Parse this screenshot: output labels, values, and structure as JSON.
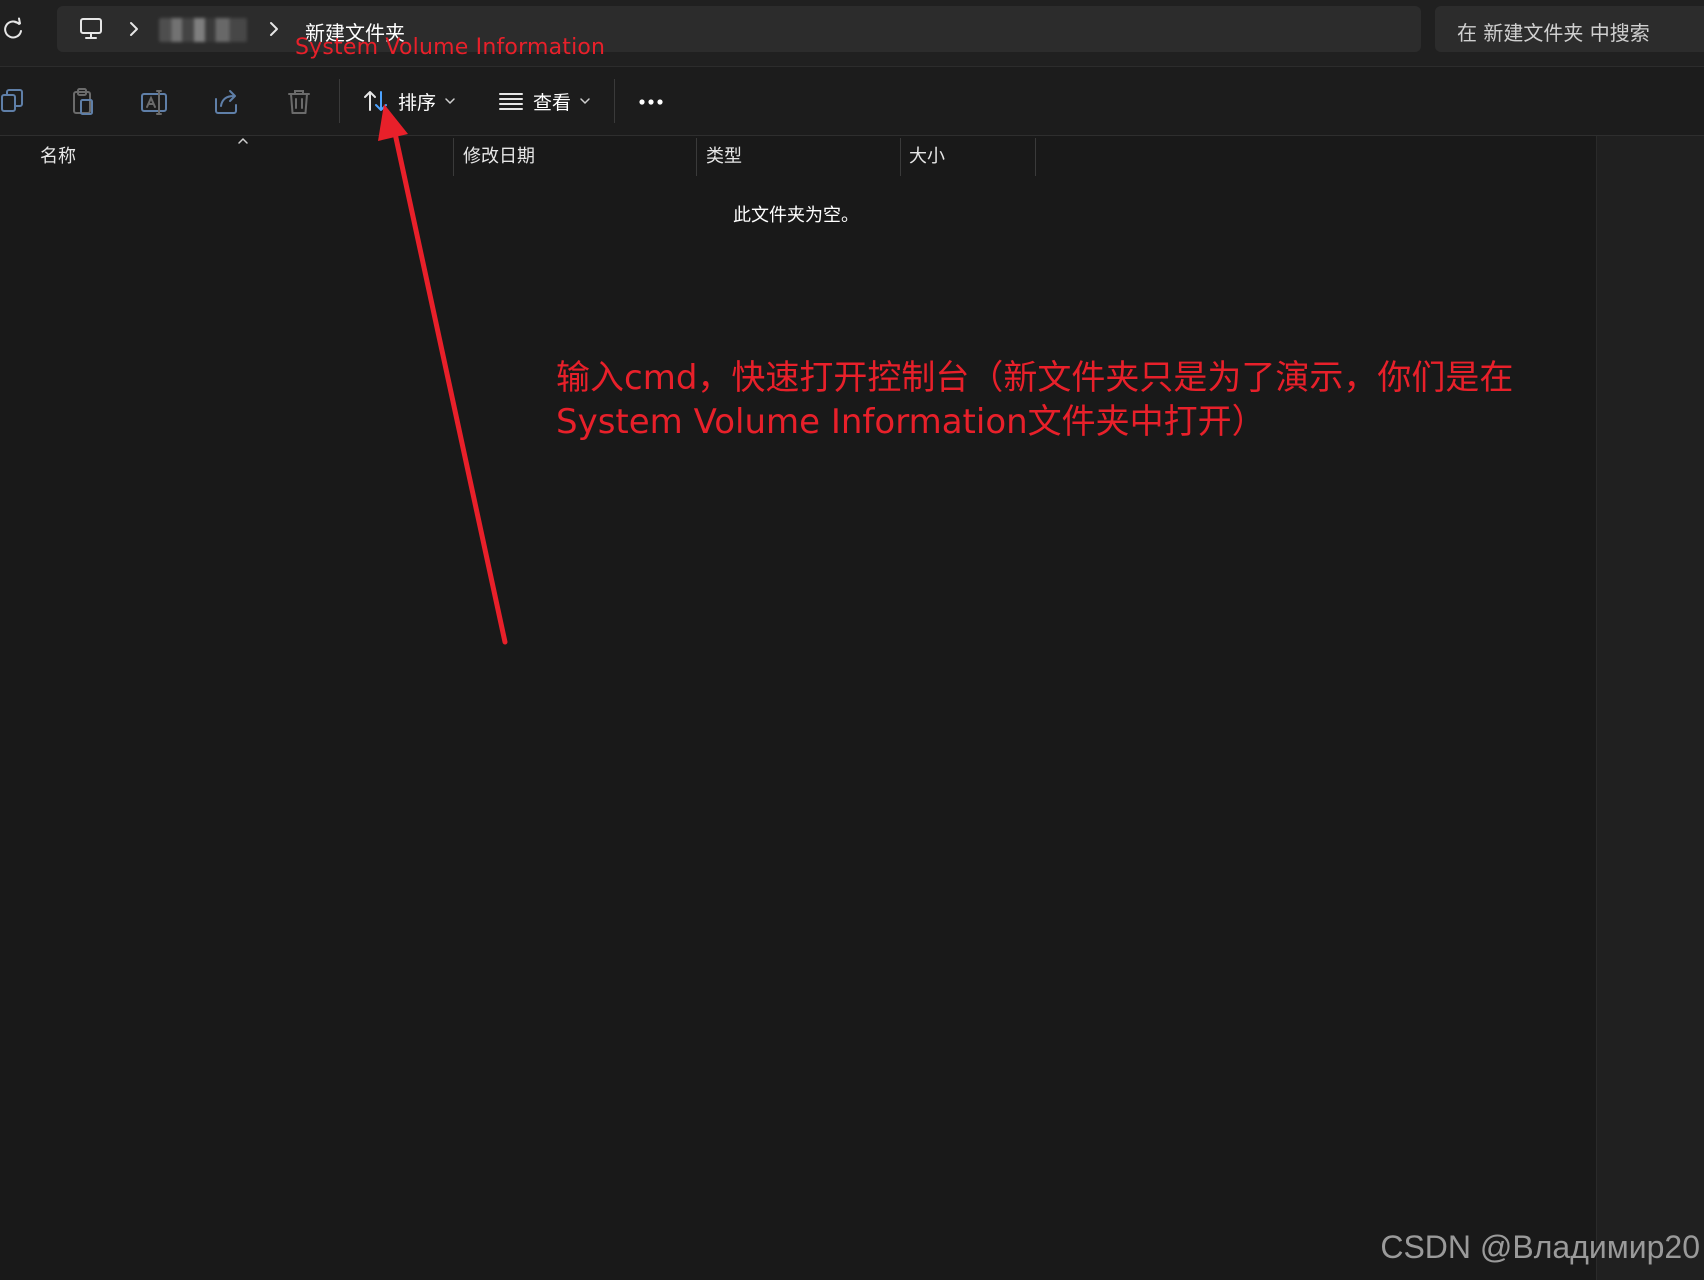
{
  "address_bar": {
    "current_folder": "新建文件夹",
    "path_overlay_annotation": "System Volume Information"
  },
  "search": {
    "placeholder": "在 新建文件夹 中搜索"
  },
  "toolbar": {
    "sort_label": "排序",
    "view_label": "查看",
    "icons": [
      "copy-icon",
      "paste-icon",
      "rename-icon",
      "share-icon",
      "delete-icon",
      "sort-icon",
      "view-icon",
      "more-icon"
    ]
  },
  "columns": [
    {
      "label": "名称"
    },
    {
      "label": "修改日期"
    },
    {
      "label": "类型"
    },
    {
      "label": "大小"
    }
  ],
  "content": {
    "empty_message": "此文件夹为空。"
  },
  "annotation": {
    "line1": "输入cmd，快速打开控制台（新文件夹只是为了演示，你们是在",
    "line2": "System Volume Information文件夹中打开）",
    "color": "#e8202a"
  },
  "watermark": "CSDN @Владимир20",
  "theme": {
    "background": "#191919",
    "bar": "#202020",
    "field": "#2c2c2c",
    "accent_sort": "#4da3ff"
  }
}
